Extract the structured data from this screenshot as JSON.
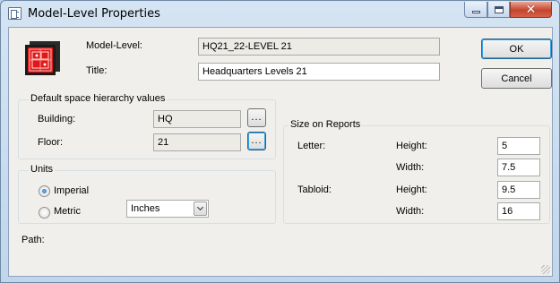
{
  "window": {
    "title": "Model-Level Properties",
    "title_icon": "properties-icon",
    "controls": {
      "minimize_icon": "minimize-icon",
      "maximize_icon": "maximize-icon",
      "close_icon": "close-icon",
      "close_glyph": "✕"
    }
  },
  "header": {
    "model_level_label": "Model-Level:",
    "model_level_value": "HQ21_22-LEVEL 21",
    "title_label": "Title:",
    "title_value": "Headquarters Levels 21",
    "logo_icon": "floor-plan-icon"
  },
  "buttons": {
    "ok": "OK",
    "cancel": "Cancel"
  },
  "hierarchy": {
    "group_title": "Default space hierarchy values",
    "building_label": "Building:",
    "building_value": "HQ",
    "floor_label": "Floor:",
    "floor_value": "21",
    "browse_label": "..."
  },
  "units": {
    "group_title": "Units",
    "imperial_label": "Imperial",
    "metric_label": "Metric",
    "selected": "Imperial",
    "unit_select_value": "Inches"
  },
  "path": {
    "label": "Path:",
    "value": ""
  },
  "reports": {
    "group_title": "Size on Reports",
    "letter_label": "Letter:",
    "tabloid_label": "Tabloid:",
    "height_label": "Height:",
    "width_label": "Width:",
    "letter": {
      "height": "5",
      "width": "7.5"
    },
    "tabloid": {
      "height": "9.5",
      "width": "16"
    }
  },
  "colors": {
    "accent": "#3ca0e0",
    "close_button": "#c6452c",
    "logo_red": "#e01818"
  }
}
